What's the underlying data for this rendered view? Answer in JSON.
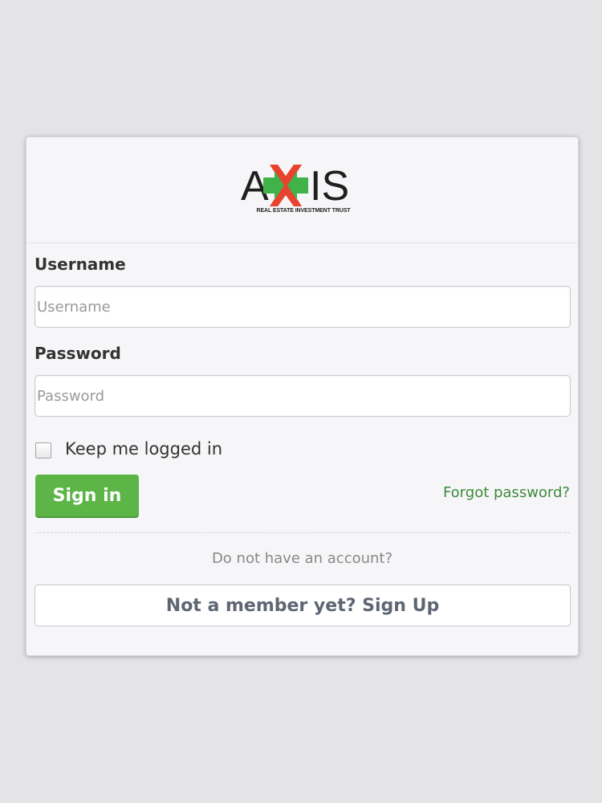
{
  "logo": {
    "word_left": "A",
    "word_right": "IS",
    "tagline": "REAL ESTATE INVESTMENT TRUST",
    "colors": {
      "red": "#e8432e",
      "green": "#3fb24a",
      "text": "#1f1f1f"
    }
  },
  "form": {
    "username_label": "Username",
    "username_placeholder": "Username",
    "username_value": "",
    "password_label": "Password",
    "password_placeholder": "Password",
    "password_value": "",
    "keep_logged_in_label": "Keep me logged in",
    "keep_logged_in_checked": false,
    "signin_label": "Sign in",
    "forgot_label": "Forgot password?"
  },
  "signup": {
    "prompt": "Do not have an account?",
    "button_label": "Not a member yet? Sign Up"
  },
  "colors": {
    "background": "#e4e3e6",
    "card": "#f6f6f8",
    "primary_button": "#5cb546",
    "link": "#3e8a3a"
  }
}
